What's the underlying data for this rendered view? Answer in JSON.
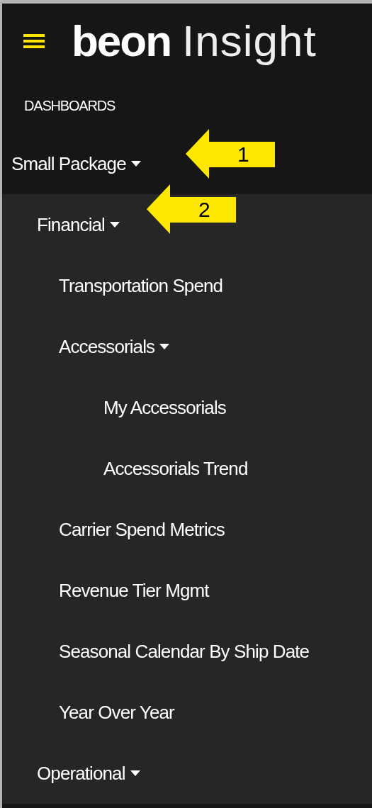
{
  "header": {
    "logo_bold": "beon",
    "logo_light": "Insight"
  },
  "section_title": "DASHBOARDS",
  "menu": [
    {
      "label": "Small Package",
      "kind": "dropdown",
      "children": [
        {
          "label": "Financial",
          "kind": "dropdown",
          "children": [
            {
              "label": "Transportation Spend",
              "kind": "link"
            },
            {
              "label": "Accessorials",
              "kind": "dropdown",
              "children": [
                {
                  "label": "My Accessorials",
                  "kind": "link"
                },
                {
                  "label": "Accessorials Trend",
                  "kind": "link"
                }
              ]
            },
            {
              "label": "Carrier Spend Metrics",
              "kind": "link"
            },
            {
              "label": "Revenue Tier Mgmt",
              "kind": "link"
            },
            {
              "label": "Seasonal Calendar By Ship Date",
              "kind": "link"
            },
            {
              "label": "Year Over Year",
              "kind": "link"
            }
          ]
        },
        {
          "label": "Operational",
          "kind": "dropdown"
        }
      ]
    }
  ],
  "annotations": [
    {
      "label": "1"
    },
    {
      "label": "2"
    }
  ]
}
